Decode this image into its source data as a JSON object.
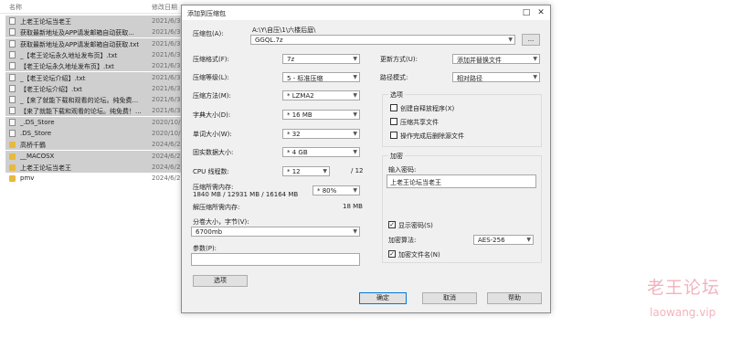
{
  "explorer": {
    "col_name": "名称",
    "col_date": "修改日期",
    "files": [
      {
        "name": "上老王论坛当老王",
        "date": "2021/6/30",
        "kind": "file",
        "selected": true
      },
      {
        "name": "获取最新地址及APP请发邮箱自动获取...",
        "date": "2021/6/30",
        "kind": "file",
        "selected": true
      },
      {
        "name": "获取最新地址及APP请发邮箱自动获取.txt",
        "date": "2021/6/30",
        "kind": "file",
        "selected": true
      },
      {
        "name": "_【老王论坛永久地址发布页】.txt",
        "date": "2021/6/30",
        "kind": "file",
        "selected": true
      },
      {
        "name": "【老王论坛永久地址发布页】.txt",
        "date": "2021/6/30",
        "kind": "file",
        "selected": true
      },
      {
        "name": "_【老王论坛介绍】.txt",
        "date": "2021/6/30",
        "kind": "file",
        "selected": true
      },
      {
        "name": "【老王论坛介绍】.txt",
        "date": "2021/6/30",
        "kind": "file",
        "selected": true
      },
      {
        "name": "_【来了就能下载和观看的论坛。纯免费...",
        "date": "2021/6/30",
        "kind": "file",
        "selected": true
      },
      {
        "name": "【来了就能下载和观看的论坛。纯免费！...",
        "date": "2021/6/30",
        "kind": "file",
        "selected": true
      },
      {
        "name": "_.DS_Store",
        "date": "2020/10/1",
        "kind": "file",
        "selected": true
      },
      {
        "name": ".DS_Store",
        "date": "2020/10/1",
        "kind": "file",
        "selected": true
      },
      {
        "name": "高桥千鶴",
        "date": "2024/6/22",
        "kind": "folder",
        "selected": true
      },
      {
        "name": "__MACOSX",
        "date": "2024/6/22",
        "kind": "folder",
        "selected": true
      },
      {
        "name": "上老王论坛当老王",
        "date": "2024/6/22",
        "kind": "folder",
        "selected": true
      },
      {
        "name": "pmv",
        "date": "2024/6/22",
        "kind": "folder",
        "selected": false
      }
    ]
  },
  "dialog": {
    "title": "添加到压缩包",
    "archive_label": "压缩包(A):",
    "archive_path": "A:\\Y\\自压\\1\\六楼后庭\\",
    "archive_name": "GGQL.7z",
    "browse_label": "...",
    "format_label": "压缩格式(F):",
    "format_value": "7z",
    "level_label": "压缩等级(L):",
    "level_value": "5 - 标准压缩",
    "method_label": "压缩方法(M):",
    "method_value": "* LZMA2",
    "dict_label": "字典大小(D):",
    "dict_value": "* 16 MB",
    "word_label": "单词大小(W):",
    "word_value": "* 32",
    "solid_label": "固实数据大小:",
    "solid_value": "* 4 GB",
    "threads_label": "CPU 线程数:",
    "threads_value": "* 12",
    "threads_max": "/ 12",
    "mem_comp_label": "压缩所需内存:",
    "mem_comp_detail": "1840 MB / 12931 MB / 16164 MB",
    "mem_comp_value": "* 80%",
    "mem_decomp_label": "解压缩所需内存:",
    "mem_decomp_value": "18 MB",
    "split_label": "分卷大小，字节(V):",
    "split_value": "6700mb",
    "params_label": "参数(P):",
    "params_value": "",
    "options_button": "选项",
    "update_label": "更新方式(U):",
    "update_value": "添加并替换文件",
    "path_label": "路径模式:",
    "path_value": "相对路径",
    "options_group": "选项",
    "opt_sfx": "创建自释放程序(X)",
    "opt_shared": "压缩共享文件",
    "opt_delete": "操作完成后删除源文件",
    "enc_group": "加密",
    "password_label": "输入密码:",
    "password_value": "上老王论坛当老王",
    "show_password": "显示密码(S)",
    "enc_method_label": "加密算法:",
    "enc_method_value": "AES-256",
    "encrypt_names": "加密文件名(N)",
    "ok": "确定",
    "cancel": "取消",
    "help": "帮助"
  },
  "watermark": {
    "text1": "老王论坛",
    "text2": "laowang.vip"
  },
  "colors": {
    "accent": "#0078d7",
    "watermark": "#f2b3bc",
    "folder": "#e8b93d",
    "selection": "#cfcfcf"
  }
}
